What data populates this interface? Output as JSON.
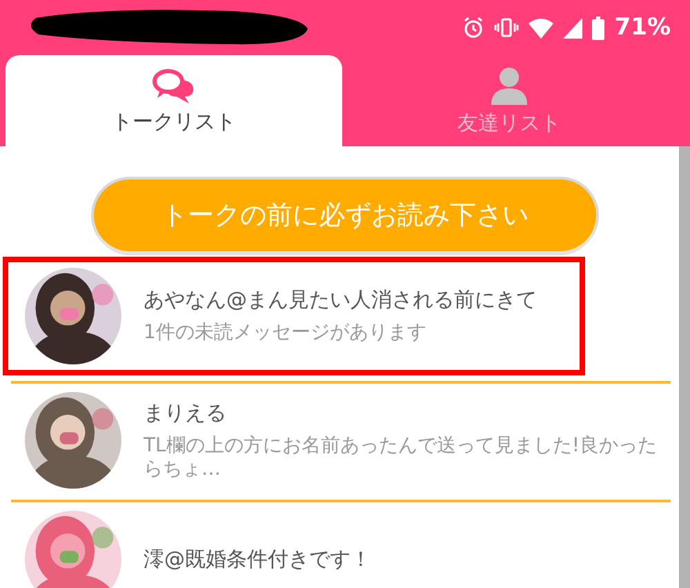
{
  "status_bar": {
    "battery_text": "71%"
  },
  "tabs": [
    {
      "label": "トークリスト",
      "selected": true,
      "kind": "talk"
    },
    {
      "label": "友達リスト",
      "selected": false,
      "kind": "friends"
    }
  ],
  "notice_button": "トークの前に必ずお読み下さい",
  "talks": [
    {
      "name": "あやなん@まん見たい人消される前にきて",
      "message": "1件の未読メッセージがあります",
      "highlighted": true
    },
    {
      "name": "まりえる",
      "message": "TL欄の上の方にお名前あったんで送って見ました!良かったらちょ…",
      "highlighted": false
    },
    {
      "name": "澪@既婚条件付きです！",
      "highlighted": false
    }
  ]
}
